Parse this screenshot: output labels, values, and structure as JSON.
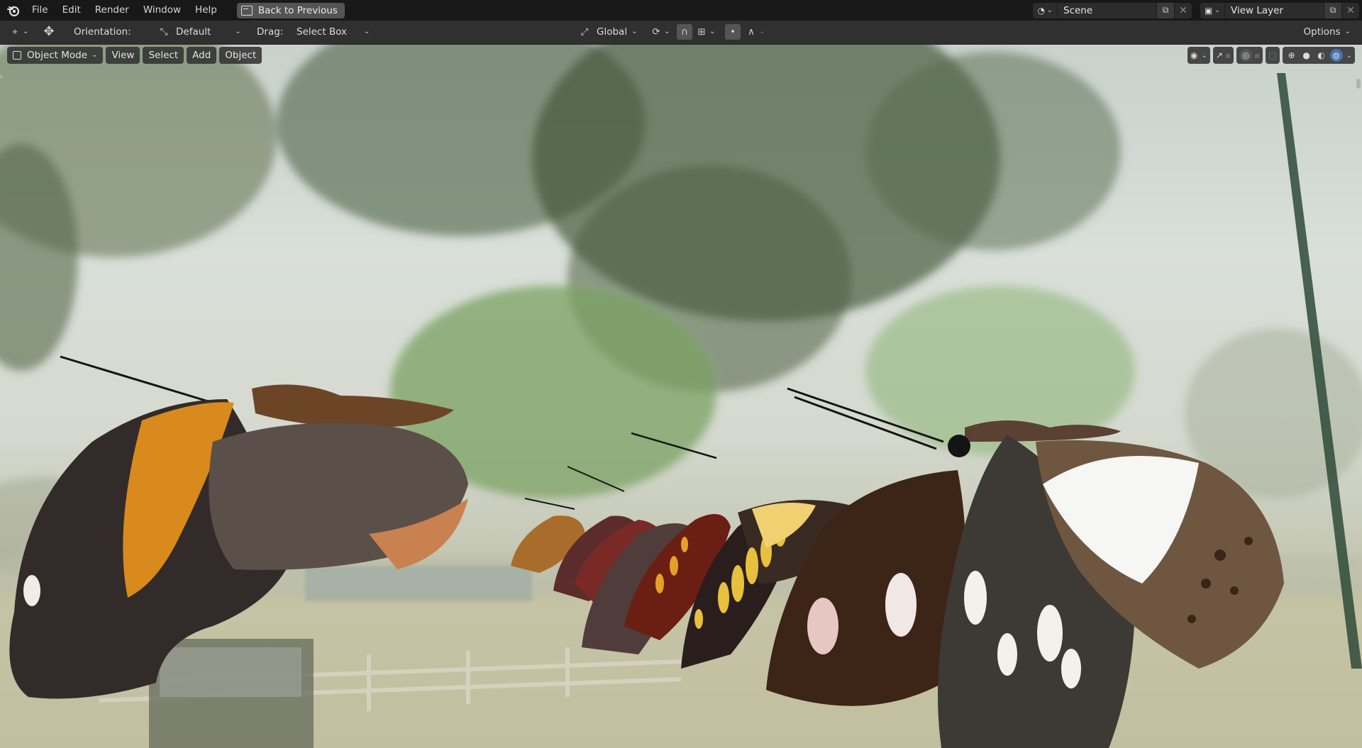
{
  "menu": {
    "items": [
      "File",
      "Edit",
      "Render",
      "Window",
      "Help"
    ],
    "back_label": "Back to Previous"
  },
  "scene_selector": {
    "value": "Scene"
  },
  "view_layer_selector": {
    "value": "View Layer"
  },
  "tool_header": {
    "orientation_label": "Orientation:",
    "orientation_value": "Default",
    "drag_label": "Drag:",
    "drag_value": "Select Box",
    "transform_orientation": "Global",
    "options_label": "Options"
  },
  "viewport": {
    "mode": "Object Mode",
    "menus": [
      "View",
      "Select",
      "Add",
      "Object"
    ]
  },
  "colors": {
    "accent": "#4772b3",
    "topbar": "#181818",
    "header": "#303030"
  }
}
